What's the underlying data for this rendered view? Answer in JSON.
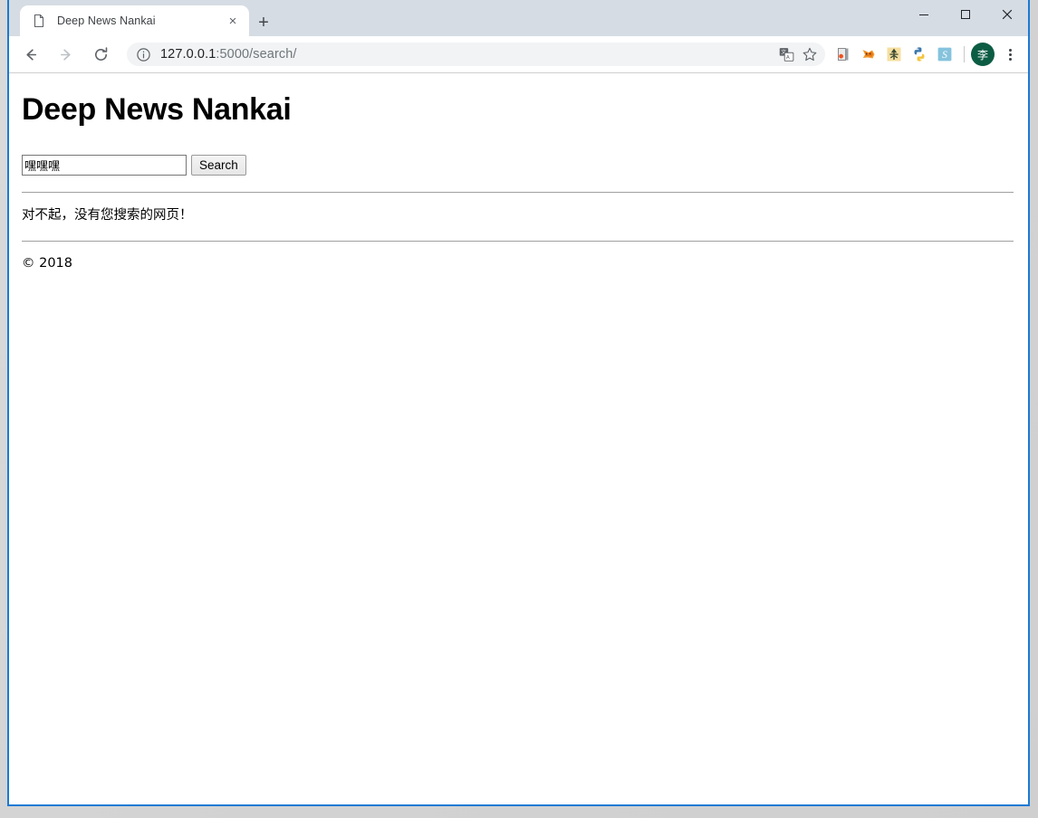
{
  "window": {
    "controls": {
      "minimize_label": "Minimize",
      "maximize_label": "Maximize",
      "close_label": "Close"
    }
  },
  "browser": {
    "tab": {
      "title": "Deep News Nankai",
      "close_label": "×",
      "favicon_name": "page-favicon"
    },
    "new_tab_label": "+",
    "nav": {
      "back_label": "Back",
      "forward_label": "Forward",
      "reload_label": "Reload"
    },
    "omnibox": {
      "url_host": "127.0.0.1",
      "url_rest": ":5000/search/",
      "full_url": "127.0.0.1:5000/search/",
      "site_info_label": "Site information",
      "translate_label": "Translate this page",
      "bookmark_label": "Bookmark this page"
    },
    "extensions": [
      {
        "name": "adblock-extension",
        "label": "AdBlock"
      },
      {
        "name": "fox-extension",
        "label": "Fox extension"
      },
      {
        "name": "yellow-extension",
        "label": "Yellow extension"
      },
      {
        "name": "python-extension",
        "label": "Python"
      },
      {
        "name": "s-extension",
        "label": "S extension"
      }
    ],
    "profile": {
      "initial": "李",
      "label": "Profile"
    },
    "menu_label": "Customize and control Google Chrome"
  },
  "page": {
    "heading": "Deep News Nankai",
    "search": {
      "value": "嘿嘿嘿",
      "placeholder": "",
      "button_label": "Search"
    },
    "message": "对不起，没有您搜索的网页！",
    "footer": "© 2018"
  },
  "colors": {
    "window_border": "#1a7ad4",
    "tab_strip_bg": "#d6dce3",
    "omnibox_bg": "#f1f3f4",
    "avatar_bg": "#0c5c44",
    "url_dim": "#70757a"
  }
}
